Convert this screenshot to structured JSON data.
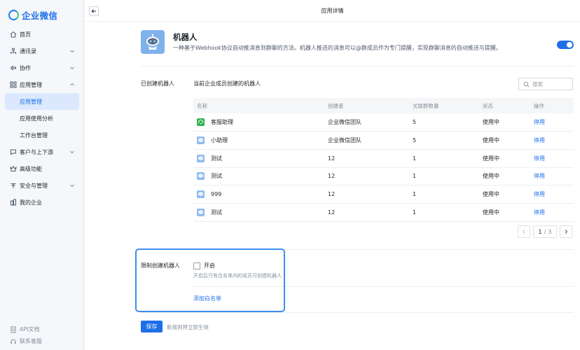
{
  "brand": {
    "name": "企业微信"
  },
  "sidebar": {
    "items": [
      {
        "label": "首页",
        "icon": "home-icon"
      },
      {
        "label": "通讯录",
        "icon": "contacts-icon"
      },
      {
        "label": "协作",
        "icon": "collab-icon"
      },
      {
        "label": "应用管理",
        "icon": "apps-icon"
      },
      {
        "label": "应用管理"
      },
      {
        "label": "应用使用分析"
      },
      {
        "label": "工作台管理"
      },
      {
        "label": "客户与上下游",
        "icon": "customer-icon"
      },
      {
        "label": "高级功能",
        "icon": "advanced-icon"
      },
      {
        "label": "安全与管理",
        "icon": "security-icon"
      },
      {
        "label": "我的企业",
        "icon": "company-icon"
      }
    ],
    "bottom": [
      {
        "label": "API文档",
        "icon": "doc-icon"
      },
      {
        "label": "联系客服",
        "icon": "service-icon"
      }
    ]
  },
  "header": {
    "title": "应用详情"
  },
  "app": {
    "name": "机器人",
    "description": "一种基于Webhook协议自动推消息到群聊的方法。机器人推送的消息可以@群成员作为专门提醒，实现群聊消息的自动推送与提醒。",
    "enabled": true,
    "accent": "#1d6fe8"
  },
  "robots": {
    "section_label": "已创建机器人",
    "subtitle": "当前企业成员创建的机器人",
    "search_placeholder": "搜索",
    "columns": [
      "名称",
      "创建者",
      "关联群数量",
      "状态",
      "操作"
    ],
    "rows": [
      {
        "name": "客服助理",
        "creator": "企业微信团队",
        "groups": "5",
        "status": "使用中",
        "action": "停用",
        "icon": "green"
      },
      {
        "name": "小助理",
        "creator": "企业微信团队",
        "groups": "5",
        "status": "使用中",
        "action": "停用",
        "icon": "blue"
      },
      {
        "name": "测试",
        "creator": "12",
        "groups": "1",
        "status": "使用中",
        "action": "停用",
        "icon": "blue"
      },
      {
        "name": "测试",
        "creator": "12",
        "groups": "1",
        "status": "使用中",
        "action": "停用",
        "icon": "blue"
      },
      {
        "name": "999",
        "creator": "12",
        "groups": "1",
        "status": "使用中",
        "action": "停用",
        "icon": "blue"
      },
      {
        "name": "测试",
        "creator": "12",
        "groups": "1",
        "status": "使用中",
        "action": "停用",
        "icon": "blue"
      }
    ],
    "pagination": {
      "current": "1",
      "separator": "/",
      "total": "3"
    }
  },
  "restrict": {
    "label": "限制创建机器人",
    "checkbox_label": "开启",
    "checked": false,
    "hint": "开启后只有白名单内的成员可创建机器人",
    "add_whitelist": "添加白名单"
  },
  "footer": {
    "save_label": "保存",
    "save_hint": "新规则将立即生效"
  }
}
